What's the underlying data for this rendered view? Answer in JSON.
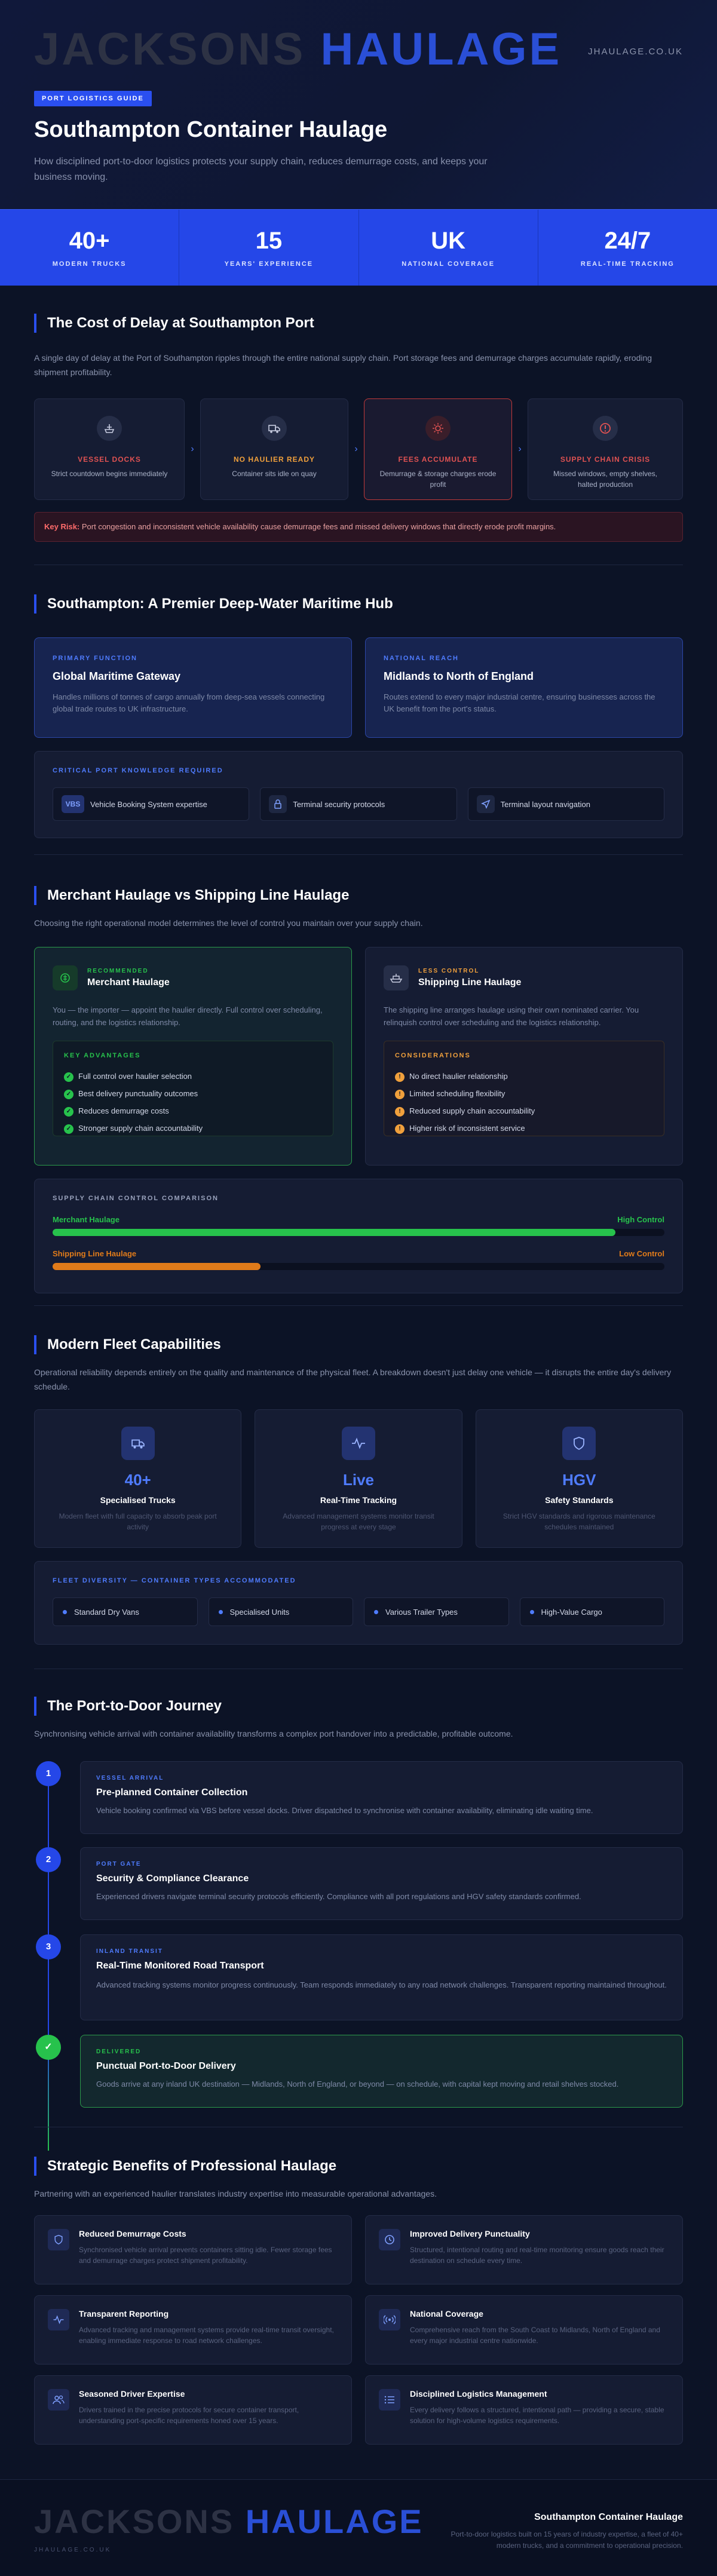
{
  "hero": {
    "logo_a": "JAC",
    "logo_b": "KS",
    "logo_full_a": "JACKSONS",
    "logo_full_b": "HAULAGE",
    "site": "JHAULAGE.CO.UK",
    "tag": "PORT LOGISTICS GUIDE",
    "title": "Southampton Container Haulage",
    "subtitle": "How disciplined port-to-door logistics protects your supply chain, reduces demurrage costs, and keeps your business moving."
  },
  "stats": [
    {
      "value": "40+",
      "label": "MODERN TRUCKS"
    },
    {
      "value": "15",
      "label": "YEARS' EXPERIENCE"
    },
    {
      "value": "UK",
      "label": "NATIONAL COVERAGE"
    },
    {
      "value": "24/7",
      "label": "REAL-TIME TRACKING"
    }
  ],
  "delay": {
    "title": "The Cost of Delay at Southampton Port",
    "intro": "A single day of delay at the Port of Southampton ripples through the entire national supply chain. Port storage fees and demurrage charges accumulate rapidly, eroding shipment profitability.",
    "steps": [
      {
        "title": "VESSEL DOCKS",
        "desc": "Strict countdown begins immediately",
        "color": "#e05252"
      },
      {
        "title": "NO HAULIER READY",
        "desc": "Container sits idle on quay",
        "color": "#f0a03c"
      },
      {
        "title": "FEES ACCUMULATE",
        "desc": "Demurrage & storage charges erode profit",
        "color": "#e05252"
      },
      {
        "title": "SUPPLY CHAIN CRISIS",
        "desc": "Missed windows, empty shelves, halted production",
        "color": "#e05252"
      }
    ],
    "risk_label": "Key Risk:",
    "risk_text": "Port congestion and inconsistent vehicle availability cause demurrage fees and missed delivery windows that directly erode profit margins."
  },
  "hub": {
    "title": "Southampton: A Premier Deep-Water Maritime Hub",
    "cards": [
      {
        "kicker": "PRIMARY FUNCTION",
        "title": "Global Maritime Gateway",
        "desc": "Handles millions of tonnes of cargo annually from deep-sea vessels connecting global trade routes to UK infrastructure."
      },
      {
        "kicker": "NATIONAL REACH",
        "title": "Midlands to North of England",
        "desc": "Routes extend to every major industrial centre, ensuring businesses across the UK benefit from the port's status."
      }
    ],
    "knowledge_title": "CRITICAL PORT KNOWLEDGE REQUIRED",
    "knowledge": [
      "Vehicle Booking System expertise",
      "Terminal security protocols",
      "Terminal layout navigation"
    ],
    "vbs": "VBS"
  },
  "model": {
    "title": "Merchant Haulage vs Shipping Line Haulage",
    "intro": "Choosing the right operational model determines the level of control you maintain over your supply chain.",
    "merchant": {
      "kicker": "RECOMMENDED",
      "title": "Merchant Haulage",
      "desc": "You — the importer — appoint the haulier directly. Full control over scheduling, routing, and the logistics relationship.",
      "list_title": "KEY ADVANTAGES",
      "items": [
        "Full control over haulier selection",
        "Best delivery punctuality outcomes",
        "Reduces demurrage costs",
        "Stronger supply chain accountability"
      ]
    },
    "shipping": {
      "kicker": "LESS CONTROL",
      "title": "Shipping Line Haulage",
      "desc": "The shipping line arranges haulage using their own nominated carrier. You relinquish control over scheduling and the logistics relationship.",
      "list_title": "CONSIDERATIONS",
      "items": [
        "No direct haulier relationship",
        "Limited scheduling flexibility",
        "Reduced supply chain accountability",
        "Higher risk of inconsistent service"
      ]
    },
    "compare_title": "SUPPLY CHAIN CONTROL COMPARISON",
    "bars": [
      {
        "name": "Merchant Haulage",
        "level": "High Control",
        "value": 0.92,
        "color": "#27c24c"
      },
      {
        "name": "Shipping Line Haulage",
        "level": "Low Control",
        "value": 0.34,
        "color": "#e07b1a"
      }
    ]
  },
  "fleet": {
    "title": "Modern Fleet Capabilities",
    "intro": "Operational reliability depends entirely on the quality and maintenance of the physical fleet. A breakdown doesn't just delay one vehicle — it disrupts the entire day's delivery schedule.",
    "cards": [
      {
        "value": "40+",
        "title": "Specialised Trucks",
        "desc": "Modern fleet with full capacity to absorb peak port activity"
      },
      {
        "value": "Live",
        "title": "Real-Time Tracking",
        "desc": "Advanced management systems monitor transit progress at every stage"
      },
      {
        "value": "HGV",
        "title": "Safety Standards",
        "desc": "Strict HGV standards and rigorous maintenance schedules maintained"
      }
    ],
    "diversity_title": "FLEET DIVERSITY — CONTAINER TYPES ACCOMMODATED",
    "types": [
      "Standard Dry Vans",
      "Specialised Units",
      "Various Trailer Types",
      "High-Value Cargo"
    ]
  },
  "journey": {
    "title": "The Port-to-Door Journey",
    "intro": "Synchronising vehicle arrival with container availability transforms a complex port handover into a predictable, profitable outcome.",
    "steps": [
      {
        "num": "1",
        "kicker": "VESSEL ARRIVAL",
        "title": "Pre-planned Container Collection",
        "desc": "Vehicle booking confirmed via VBS before vessel docks. Driver dispatched to synchronise with container availability, eliminating idle waiting time."
      },
      {
        "num": "2",
        "kicker": "PORT GATE",
        "title": "Security & Compliance Clearance",
        "desc": "Experienced drivers navigate terminal security protocols efficiently. Compliance with all port regulations and HGV safety standards confirmed."
      },
      {
        "num": "3",
        "kicker": "INLAND TRANSIT",
        "title": "Real-Time Monitored Road Transport",
        "desc": "Advanced tracking systems monitor progress continuously. Team responds immediately to any road network challenges. Transparent reporting maintained throughout."
      },
      {
        "num": "✓",
        "kicker": "DELIVERED",
        "title": "Punctual Port-to-Door Delivery",
        "desc": "Goods arrive at any inland UK destination — Midlands, North of England, or beyond — on schedule, with capital kept moving and retail shelves stocked."
      }
    ]
  },
  "benefits": {
    "title": "Strategic Benefits of Professional Haulage",
    "intro": "Partnering with an experienced haulier translates industry expertise into measurable operational advantages.",
    "items": [
      {
        "title": "Reduced Demurrage Costs",
        "desc": "Synchronised vehicle arrival prevents containers sitting idle. Fewer storage fees and demurrage charges protect shipment profitability.",
        "icon": "shield-icon"
      },
      {
        "title": "Improved Delivery Punctuality",
        "desc": "Structured, intentional routing and real-time monitoring ensure goods reach their destination on schedule every time.",
        "icon": "clock-icon"
      },
      {
        "title": "Transparent Reporting",
        "desc": "Advanced tracking and management systems provide real-time transit oversight, enabling immediate response to road network challenges.",
        "icon": "pulse-icon"
      },
      {
        "title": "National Coverage",
        "desc": "Comprehensive reach from the South Coast to Midlands, North of England and every major industrial centre nationwide.",
        "icon": "broadcast-icon"
      },
      {
        "title": "Seasoned Driver Expertise",
        "desc": "Drivers trained in the precise protocols for secure container transport, understanding port-specific requirements honed over 15 years.",
        "icon": "users-icon"
      },
      {
        "title": "Disciplined Logistics Management",
        "desc": "Every delivery follows a structured, intentional path — providing a secure, stable solution for high-volume logistics requirements.",
        "icon": "list-icon"
      }
    ]
  },
  "footer": {
    "logo_a": "JAC",
    "logo_b": "KS",
    "site": "JHAULAGE.CO.UK",
    "title": "Southampton Container Haulage",
    "desc": "Port-to-door logistics built on 15 years of industry expertise, a fleet of 40+ modern trucks, and a commitment to operational precision."
  }
}
